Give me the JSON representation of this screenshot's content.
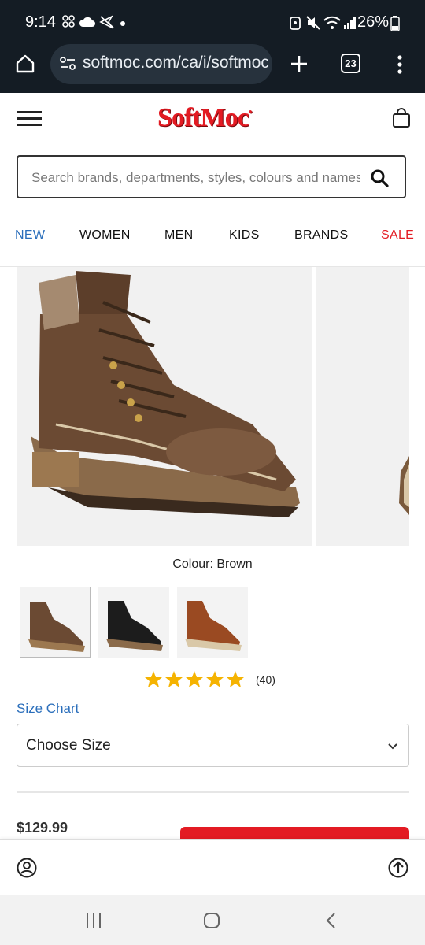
{
  "status_bar": {
    "time": "9:14",
    "battery": "26%"
  },
  "browser": {
    "url": "softmoc.com/ca/i/softmoc",
    "tab_count": "23"
  },
  "site": {
    "logo_text": "SoftMoc",
    "search_placeholder": "Search brands, departments, styles, colours and names",
    "nav": [
      {
        "label": "NEW",
        "color": "#2a6ebb"
      },
      {
        "label": "WOMEN",
        "color": "#111111"
      },
      {
        "label": "MEN",
        "color": "#111111"
      },
      {
        "label": "KIDS",
        "color": "#111111"
      },
      {
        "label": "BRANDS",
        "color": "#111111"
      },
      {
        "label": "SALE",
        "color": "#e31b23"
      }
    ]
  },
  "product": {
    "colour_label": "Colour: Brown",
    "swatches": [
      {
        "name": "brown",
        "selected": true
      },
      {
        "name": "black",
        "selected": false
      },
      {
        "name": "tan",
        "selected": false
      }
    ],
    "rating_stars": 5,
    "rating_count": "(40)",
    "size_chart_label": "Size Chart",
    "size_select_value": "Choose Size",
    "price": "$129.99"
  },
  "colors": {
    "brand_red": "#e31b23",
    "link_blue": "#2a6ebb",
    "star_gold": "#f5b301"
  }
}
